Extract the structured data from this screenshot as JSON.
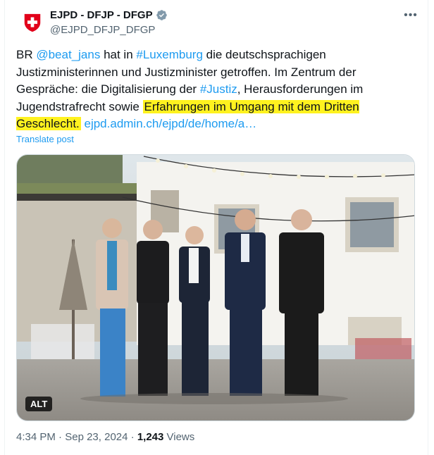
{
  "author": {
    "display_name": "EJPD - DFJP - DFGP",
    "handle": "@EJPD_DFJP_DFGP",
    "avatar_icon": "swiss-flag-icon",
    "verified_icon": "verified-badge-icon"
  },
  "menu": {
    "more_icon": "ellipsis-icon",
    "more_label": "•••"
  },
  "tweet": {
    "segments": {
      "s1": "BR ",
      "mention": "@beat_jans",
      "s2": " hat in ",
      "hashtag1": "#Luxemburg",
      "s3": " die deutschsprachigen Justizministerinnen und Justizminister getroffen. Im Zentrum der Gespräche: die Digitalisierung der ",
      "hashtag2": "#Justiz",
      "s4": ", Herausforderungen im Jugendstrafrecht sowie ",
      "highlight": "Erfahrungen im Umgang mit dem Dritten Geschlecht.",
      "s5": " ",
      "url": "ejpd.admin.ch/ejpd/de/home/a…"
    },
    "translate_label": "Translate post"
  },
  "media": {
    "alt_label": "ALT",
    "description": "photo"
  },
  "meta": {
    "time": "4:34 PM",
    "sep1": " · ",
    "date": "Sep 23, 2024",
    "sep2": " · ",
    "views_count": "1,243",
    "views_label": " Views"
  },
  "colors": {
    "link": "#1d9bf0",
    "highlight": "#fff21f",
    "secondary_text": "#536471",
    "verified": "#829aab",
    "flag_red": "#e2001a"
  }
}
